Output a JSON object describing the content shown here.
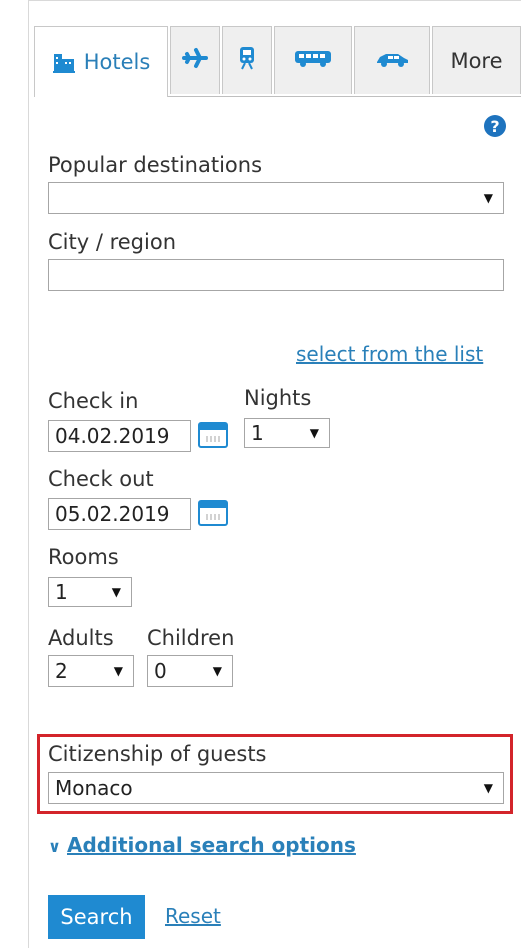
{
  "tabs": [
    {
      "id": "hotels",
      "label": "Hotels",
      "icon": "hotel-icon",
      "active": true
    },
    {
      "id": "flights",
      "label": "",
      "icon": "airplane-icon",
      "active": false
    },
    {
      "id": "trains",
      "label": "",
      "icon": "train-icon",
      "active": false
    },
    {
      "id": "bus",
      "label": "",
      "icon": "bus-icon",
      "active": false
    },
    {
      "id": "car",
      "label": "",
      "icon": "car-icon",
      "active": false
    },
    {
      "id": "more",
      "label": "More",
      "icon": "",
      "active": false
    }
  ],
  "help_label": "?",
  "form": {
    "popular_destinations_label": "Popular destinations",
    "popular_destinations_value": "",
    "city_region_label": "City / region",
    "city_region_value": "",
    "select_from_list_link": "select from the list",
    "check_in_label": "Check in",
    "check_in_value": "04.02.2019",
    "nights_label": "Nights",
    "nights_value": "1",
    "check_out_label": "Check out",
    "check_out_value": "05.02.2019",
    "rooms_label": "Rooms",
    "rooms_value": "1",
    "adults_label": "Adults",
    "adults_value": "2",
    "children_label": "Children",
    "children_value": "0",
    "citizenship_label": "Citizenship of guests",
    "citizenship_value": "Monaco",
    "additional_options_link": "Additional search options",
    "search_button": "Search",
    "reset_link": "Reset"
  },
  "colors": {
    "accent": "#1f8ad1",
    "highlight_border": "#d3242a",
    "link": "#2a80b9"
  }
}
